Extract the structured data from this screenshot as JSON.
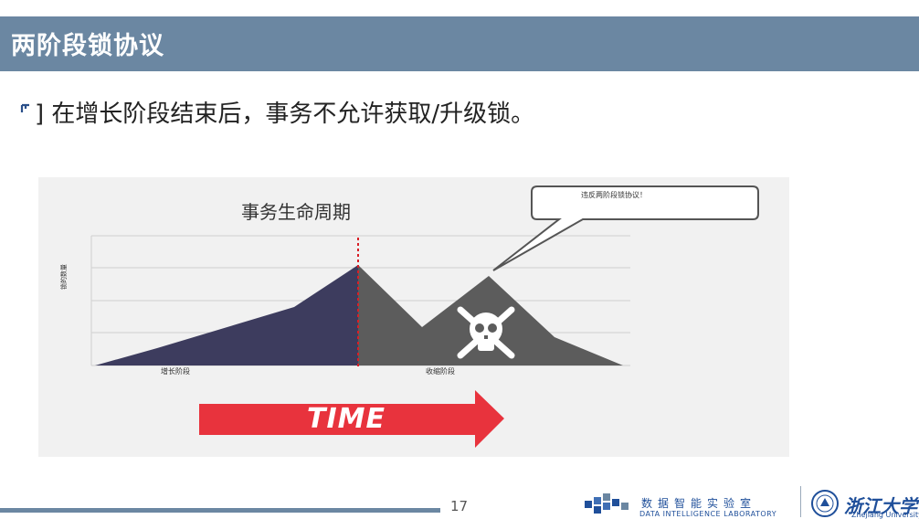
{
  "slide": {
    "title": "两阶段锁协议",
    "bullet": "] 在增长阶段结束后，事务不允许获取/升级锁。",
    "page_number": "17"
  },
  "figure": {
    "chart_title": "事务生命周期",
    "y_axis_label": "锁的数量",
    "growing_label": "增长阶段",
    "shrinking_label": "收缩阶段",
    "callout_text": "违反两阶段锁协议！",
    "arrow_text": "TIME",
    "colors": {
      "growing": "#3d3c5e",
      "shrinking": "#5c5c5c",
      "arrow": "#e8333d",
      "divider": "#d81f26"
    }
  },
  "footer": {
    "lab_name_cn": "数据智能实验室",
    "lab_name_en": "DATA INTELLIGENCE LABORATORY",
    "university_cn": "浙江大学",
    "university_en": "Zhejiang University"
  }
}
